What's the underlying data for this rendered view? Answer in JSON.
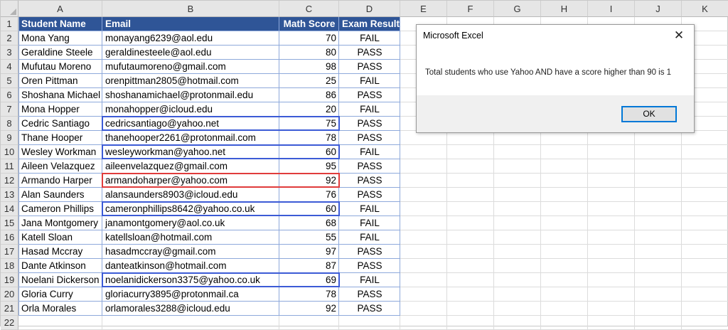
{
  "sheet": {
    "columns": [
      "A",
      "B",
      "C",
      "D",
      "E",
      "F",
      "G",
      "H",
      "I",
      "J",
      "K"
    ],
    "row_numbers": [
      "1",
      "2",
      "3",
      "4",
      "5",
      "6",
      "7",
      "8",
      "9",
      "10",
      "11",
      "12",
      "13",
      "14",
      "15",
      "16",
      "17",
      "18",
      "19",
      "20",
      "21",
      "22"
    ],
    "headers": [
      "Student Name",
      "Email",
      "Math Score",
      "Exam Result"
    ],
    "rows": [
      [
        "Mona Yang",
        "monayang6239@aol.edu",
        "70",
        "FAIL"
      ],
      [
        "Geraldine Steele",
        "geraldinesteele@aol.edu",
        "80",
        "PASS"
      ],
      [
        "Mufutau Moreno",
        "mufutaumoreno@gmail.com",
        "98",
        "PASS"
      ],
      [
        "Oren Pittman",
        "orenpittman2805@hotmail.com",
        "25",
        "FAIL"
      ],
      [
        "Shoshana Michael",
        "shoshanamichael@protonmail.edu",
        "86",
        "PASS"
      ],
      [
        "Mona Hopper",
        "monahopper@icloud.edu",
        "20",
        "FAIL"
      ],
      [
        "Cedric Santiago",
        "cedricsantiago@yahoo.net",
        "75",
        "PASS"
      ],
      [
        "Thane Hooper",
        "thanehooper2261@protonmail.com",
        "78",
        "PASS"
      ],
      [
        "Wesley Workman",
        "wesleyworkman@yahoo.net",
        "60",
        "FAIL"
      ],
      [
        "Aileen Velazquez",
        "aileenvelazquez@gmail.com",
        "95",
        "PASS"
      ],
      [
        "Armando Harper",
        "armandoharper@yahoo.com",
        "92",
        "PASS"
      ],
      [
        "Alan Saunders",
        "alansaunders8903@icloud.edu",
        "76",
        "PASS"
      ],
      [
        "Cameron Phillips",
        "cameronphillips8642@yahoo.co.uk",
        "60",
        "FAIL"
      ],
      [
        "Jana Montgomery",
        "janamontgomery@aol.co.uk",
        "68",
        "FAIL"
      ],
      [
        "Katell Sloan",
        "katellsloan@hotmail.com",
        "55",
        "FAIL"
      ],
      [
        "Hasad Mccray",
        "hasadmccray@gmail.com",
        "97",
        "PASS"
      ],
      [
        "Dante Atkinson",
        "danteatkinson@hotmail.com",
        "87",
        "PASS"
      ],
      [
        "Noelani Dickerson",
        "noelanidickerson3375@yahoo.co.uk",
        "69",
        "FAIL"
      ],
      [
        "Gloria Curry",
        "gloriacurry3895@protonmail.ca",
        "78",
        "PASS"
      ],
      [
        "Orla Morales",
        "orlamorales3288@icloud.edu",
        "92",
        "PASS"
      ]
    ],
    "header_fill": "#2f5597",
    "highlight_blue_rows": [
      8,
      10,
      14,
      19
    ],
    "highlight_red_rows": [
      12
    ],
    "highlight_blue_color": "#3c5bd6",
    "highlight_red_color": "#e03c3c"
  },
  "dialog": {
    "title": "Microsoft Excel",
    "close_glyph": "✕",
    "message": "Total students who use Yahoo AND have a score higher than 90 is 1",
    "ok_label": "OK"
  }
}
